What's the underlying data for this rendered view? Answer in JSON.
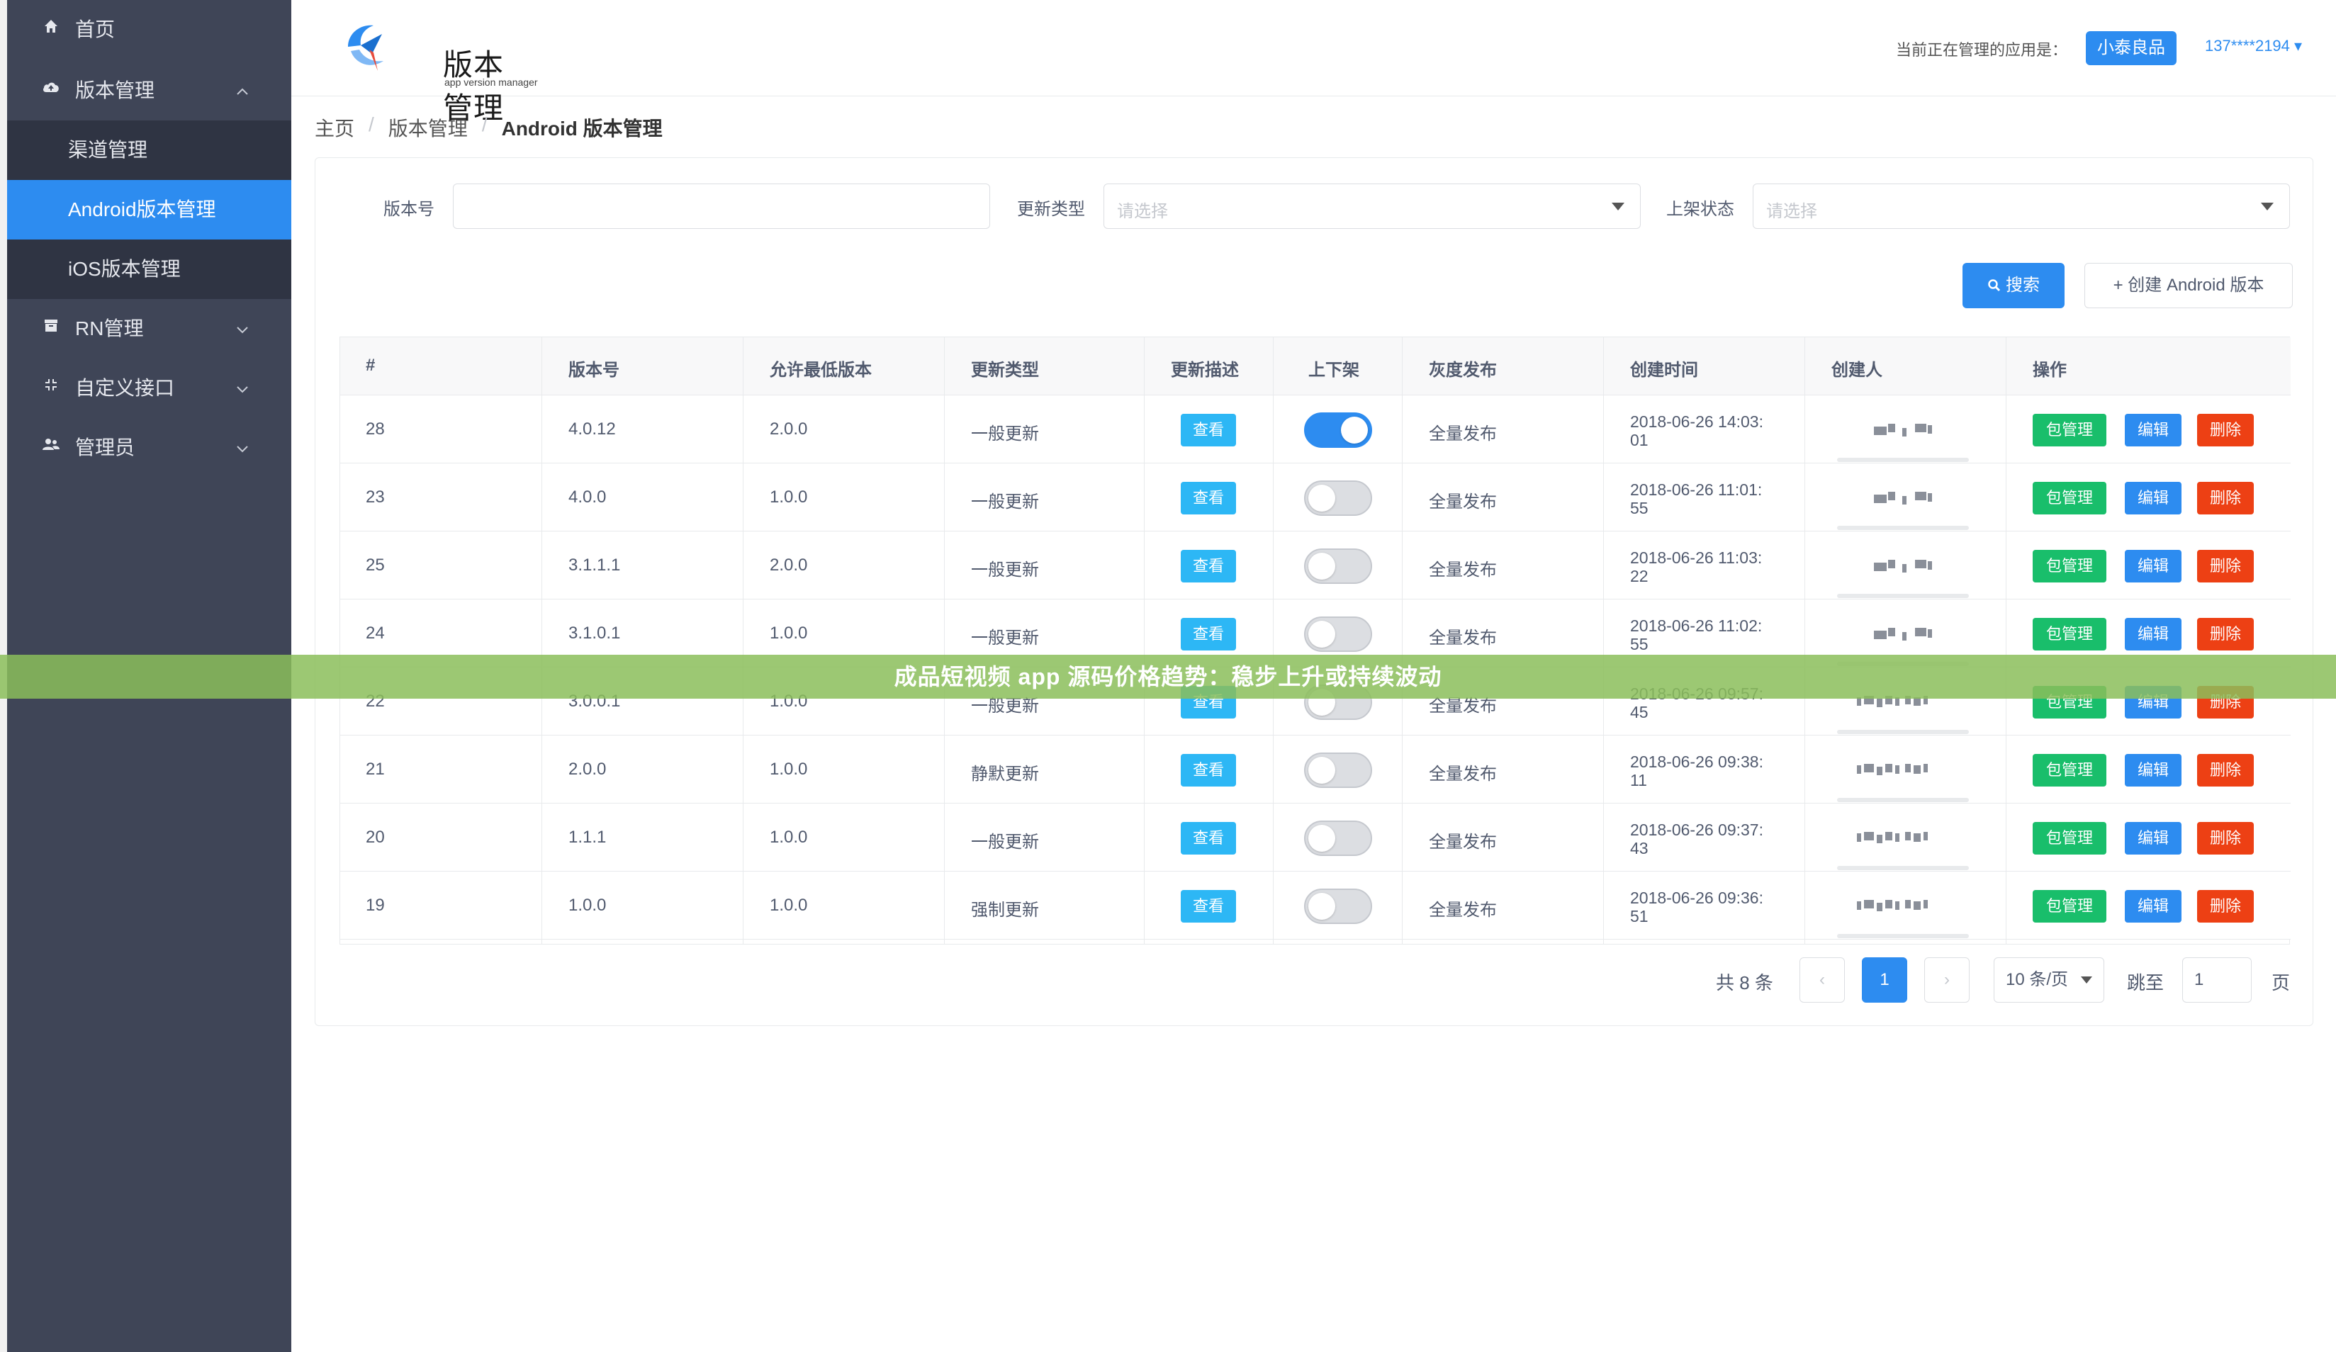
{
  "sidebar": {
    "items": [
      {
        "label": "首页",
        "icon": "home-icon"
      },
      {
        "label": "版本管理",
        "icon": "cloud-upload-icon",
        "arrow": "⌃"
      },
      {
        "label": "RN管理",
        "icon": "archive-icon",
        "arrow": "⌄"
      },
      {
        "label": "自定义接口",
        "icon": "expand-icon",
        "arrow": "⌄"
      },
      {
        "label": "管理员",
        "icon": "users-icon",
        "arrow": "⌄"
      }
    ],
    "submenu": [
      {
        "label": "渠道管理"
      },
      {
        "label": "Android版本管理"
      },
      {
        "label": "iOS版本管理"
      }
    ]
  },
  "header": {
    "logo_title": "版本管理",
    "logo_subtitle": "app version manager",
    "current_app_label": "当前正在管理的应用是：",
    "current_app": "小泰良品",
    "user": "137****2194 ▾"
  },
  "breadcrumb": {
    "home": "主页",
    "section": "版本管理",
    "current": "Android 版本管理",
    "separator": "/"
  },
  "filters": {
    "version_label": "版本号",
    "update_type_label": "更新类型",
    "update_type_placeholder": "请选择",
    "status_label": "上架状态",
    "status_placeholder": "请选择",
    "search_button": "搜索",
    "create_button": "+ 创建 Android 版本"
  },
  "table": {
    "headers": [
      "#",
      "版本号",
      "允许最低版本",
      "更新类型",
      "更新描述",
      "上下架",
      "灰度发布",
      "创建时间",
      "创建人",
      "操作"
    ],
    "view_label": "查看",
    "pkg_label": "包管理",
    "edit_label": "编辑",
    "delete_label": "删除",
    "rows": [
      {
        "id": "28",
        "version": "4.0.12",
        "min_version": "2.0.0",
        "update_type": "一般更新",
        "on_shelf": true,
        "gray": "全量发布",
        "time1": "2018-06-26 14:03:",
        "time2": "01"
      },
      {
        "id": "23",
        "version": "4.0.0",
        "min_version": "1.0.0",
        "update_type": "一般更新",
        "on_shelf": false,
        "gray": "全量发布",
        "time1": "2018-06-26 11:01:",
        "time2": "55"
      },
      {
        "id": "25",
        "version": "3.1.1.1",
        "min_version": "2.0.0",
        "update_type": "一般更新",
        "on_shelf": false,
        "gray": "全量发布",
        "time1": "2018-06-26 11:03:",
        "time2": "22"
      },
      {
        "id": "24",
        "version": "3.1.0.1",
        "min_version": "1.0.0",
        "update_type": "一般更新",
        "on_shelf": false,
        "gray": "全量发布",
        "time1": "2018-06-26 11:02:",
        "time2": "55"
      },
      {
        "id": "22",
        "version": "3.0.0.1",
        "min_version": "1.0.0",
        "update_type": "一般更新",
        "on_shelf": false,
        "gray": "全量发布",
        "time1": "2018-06-26 09:57:",
        "time2": "45"
      },
      {
        "id": "21",
        "version": "2.0.0",
        "min_version": "1.0.0",
        "update_type": "静默更新",
        "on_shelf": false,
        "gray": "全量发布",
        "time1": "2018-06-26 09:38:",
        "time2": "11"
      },
      {
        "id": "20",
        "version": "1.1.1",
        "min_version": "1.0.0",
        "update_type": "一般更新",
        "on_shelf": false,
        "gray": "全量发布",
        "time1": "2018-06-26 09:37:",
        "time2": "43"
      },
      {
        "id": "19",
        "version": "1.0.0",
        "min_version": "1.0.0",
        "update_type": "强制更新",
        "on_shelf": false,
        "gray": "全量发布",
        "time1": "2018-06-26 09:36:",
        "time2": "51"
      }
    ]
  },
  "pagination": {
    "total": "共 8 条",
    "prev": "‹",
    "current_page": "1",
    "next": "›",
    "page_size": "10 条/页",
    "jump_label": "跳至",
    "jump_value": "1",
    "page_suffix": "页"
  },
  "banner": {
    "text": "成品短视频 app 源码价格趋势：稳步上升或持续波动"
  },
  "colors": {
    "primary": "#2d8cf0",
    "success": "#19be6b",
    "danger": "#ed4014",
    "info": "#2db7f5",
    "sidebar": "#3f4557"
  }
}
